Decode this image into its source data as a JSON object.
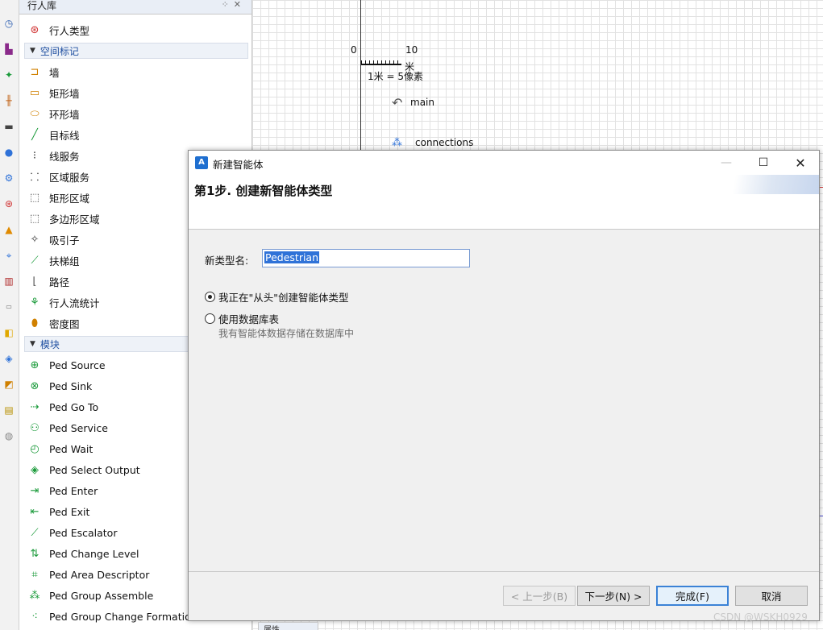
{
  "palette": {
    "title": "行人库",
    "ped_type": "行人类型",
    "section_space": "空间标记",
    "space_items": [
      "墙",
      "矩形墙",
      "环形墙",
      "目标线",
      "线服务",
      "区域服务",
      "矩形区域",
      "多边形区域",
      "吸引子",
      "扶梯组",
      "路径",
      "行人流统计",
      "密度图"
    ],
    "section_blocks": "模块",
    "block_items": [
      "Ped Source",
      "Ped Sink",
      "Ped Go To",
      "Ped Service",
      "Ped Wait",
      "Ped Select Output",
      "Ped Enter",
      "Ped Exit",
      "Ped Escalator",
      "Ped Change Level",
      "Ped Area Descriptor",
      "Ped Group Assemble",
      "Ped Group Change Formation"
    ]
  },
  "canvas": {
    "scale_zero": "0",
    "scale_ten": "10",
    "scale_unit": "米",
    "scale_text": "1米 = 5像素",
    "main_label": "main",
    "connections_label": "connections"
  },
  "dialog": {
    "title": "新建智能体",
    "step_title": "第1步. 创建新智能体类型",
    "name_label": "新类型名:",
    "name_value": "Pedestrian",
    "radio_scratch": "我正在\"从头\"创建智能体类型",
    "radio_db": "使用数据库表",
    "db_hint": "我有智能体数据存储在数据库中",
    "btn_back": "< 上一步(B)",
    "btn_next": "下一步(N) >",
    "btn_finish": "完成(F)",
    "btn_cancel": "取消"
  },
  "bottom_tab": "属性",
  "watermark": "CSDN @WSKH0929",
  "colors": {
    "accent": "#2f72d8",
    "section_text": "#1f4fa0",
    "edit_button": "#fde99a"
  }
}
